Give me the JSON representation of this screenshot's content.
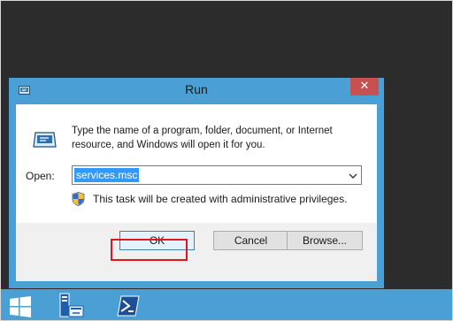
{
  "window": {
    "title": "Run",
    "close_glyph": "✕"
  },
  "dialog": {
    "description": "Type the name of a program, folder, document, or Internet resource, and Windows will open it for you.",
    "open_label": "Open:",
    "open_value": "services.msc",
    "admin_note": "This task will be created with administrative privileges.",
    "icons": {
      "title": "run-icon",
      "main": "run-icon",
      "shield": "uac-shield-icon",
      "dropdown": "chevron-down-icon"
    }
  },
  "buttons": {
    "ok": "OK",
    "cancel": "Cancel",
    "browse": "Browse..."
  },
  "taskbar": {
    "items": [
      "start-icon",
      "server-manager-icon",
      "powershell-icon"
    ]
  },
  "colors": {
    "window_frame": "#4a9fd4",
    "close_button": "#c75050",
    "selection": "#3399ff",
    "highlight_box": "#e3141f",
    "desktop": "#2c2c2c"
  }
}
